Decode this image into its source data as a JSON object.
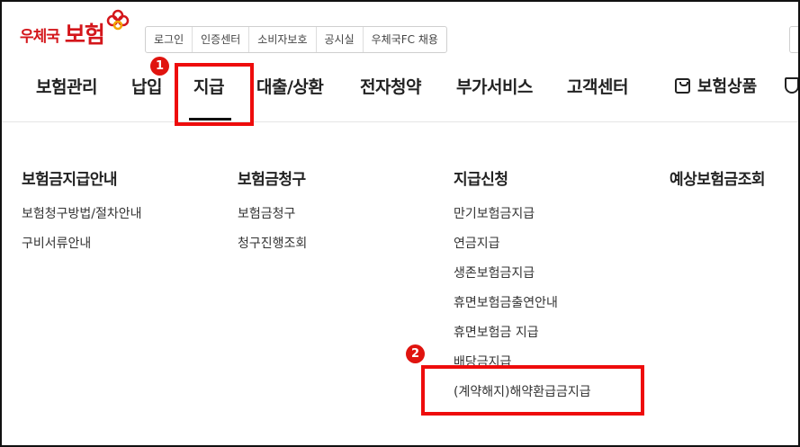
{
  "logo": {
    "small": "우체국",
    "big": "보험"
  },
  "util_links": [
    "로그인",
    "인증센터",
    "소비자보호",
    "공시실",
    "우체국FC 채용"
  ],
  "gnb": [
    {
      "id": "insurance-mgmt",
      "label": "보험관리"
    },
    {
      "id": "payment",
      "label": "납입"
    },
    {
      "id": "claim-pay",
      "label": "지급"
    },
    {
      "id": "loan",
      "label": "대출/상환"
    },
    {
      "id": "e-subscription",
      "label": "전자청약"
    },
    {
      "id": "extra-services",
      "label": "부가서비스"
    },
    {
      "id": "customer-center",
      "label": "고객센터"
    }
  ],
  "products": {
    "label": "보험상품",
    "icon": "bag-icon"
  },
  "megamenu": [
    {
      "heading": "보험금지급안내",
      "items": [
        "보험청구방법/절차안내",
        "구비서류안내"
      ]
    },
    {
      "heading": "보험금청구",
      "items": [
        "보험금청구",
        "청구진행조회"
      ]
    },
    {
      "heading": "지급신청",
      "items": [
        "만기보험금지급",
        "연금지급",
        "생존보험금지급",
        "휴면보험금출연안내",
        "휴면보험금 지급",
        "배당금지급",
        "(계약해지)해약환급금지급"
      ]
    },
    {
      "heading": "예상보험금조회",
      "items": []
    }
  ],
  "annotations": {
    "step1": "1",
    "step2": "2"
  },
  "colors": {
    "brand_red": "#d4161b",
    "callout_red": "#ee0c0c"
  }
}
